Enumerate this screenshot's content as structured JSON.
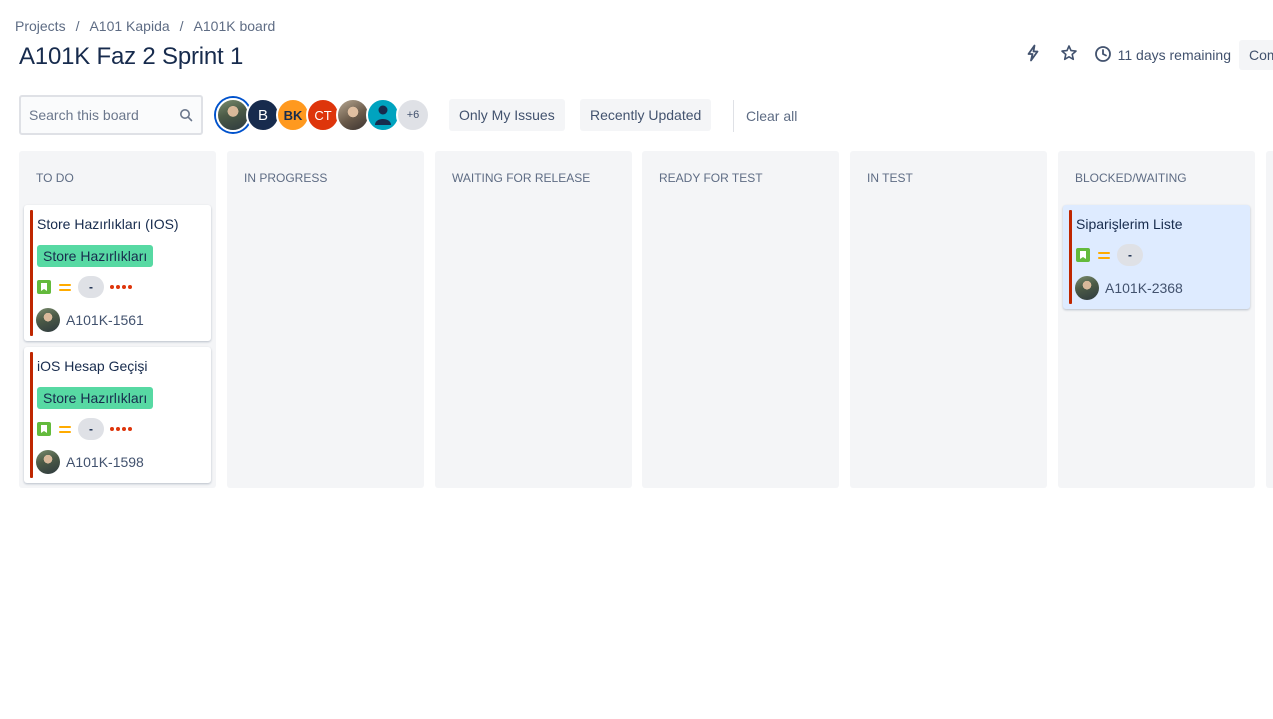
{
  "breadcrumb": {
    "items": [
      "Projects",
      "A101 Kapida",
      "A101K board"
    ],
    "separator": "/"
  },
  "page": {
    "title": "A101K Faz 2 Sprint 1"
  },
  "header_actions": {
    "remaining": "11 days remaining",
    "complete_label": "Complete sprint"
  },
  "search": {
    "placeholder": "Search this board",
    "value": ""
  },
  "avatars": {
    "initials": [
      "B",
      "BK",
      "CT"
    ],
    "more_count": "+6",
    "colors": {
      "b": "#172b4d",
      "bk": "#ff991f",
      "ct": "#de350b",
      "generic": "#00a3bf"
    }
  },
  "filters": {
    "only_my_issues": "Only My Issues",
    "recently_updated": "Recently Updated",
    "clear_all": "Clear all"
  },
  "columns": [
    {
      "title": "TO DO",
      "cards": [
        {
          "title": "Store Hazırlıkları (IOS)",
          "epic": "Store Hazırlıkları",
          "estimate": "-",
          "key": "A101K-1561",
          "flagged": true,
          "issue_type": "story",
          "priority": "medium"
        },
        {
          "title": "iOS Hesap Geçişi",
          "epic": "Store Hazırlıkları",
          "estimate": "-",
          "key": "A101K-1598",
          "flagged": true,
          "issue_type": "story",
          "priority": "medium"
        }
      ]
    },
    {
      "title": "IN PROGRESS",
      "cards": []
    },
    {
      "title": "WAITING FOR RELEASE",
      "cards": []
    },
    {
      "title": "READY FOR TEST",
      "cards": []
    },
    {
      "title": "IN TEST",
      "cards": []
    },
    {
      "title": "BLOCKED/WAITING",
      "cards": [
        {
          "title": "Siparişlerim Liste",
          "estimate": "-",
          "key": "A101K-2368",
          "flagged": true,
          "issue_type": "story",
          "priority": "medium",
          "highlighted": true
        }
      ]
    }
  ],
  "colors": {
    "epic": "#57d9a3",
    "flag": "#bf2600",
    "story": "#63ba3c",
    "priority_medium": "#ffab00",
    "highlight_card": "#deebff"
  }
}
